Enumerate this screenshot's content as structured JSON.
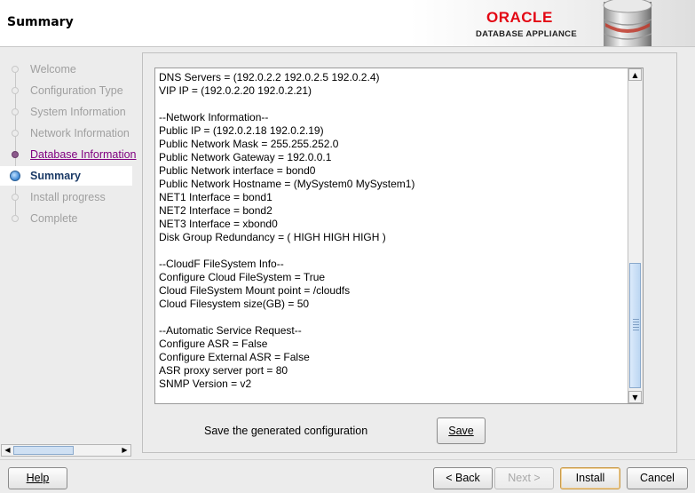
{
  "header": {
    "title": "Summary",
    "brand_oracle": "ORACLE",
    "brand_appliance": "DATABASE APPLIANCE"
  },
  "nav": {
    "steps": [
      {
        "label": "Welcome",
        "state": "done"
      },
      {
        "label": "Configuration Type",
        "state": "done"
      },
      {
        "label": "System Information",
        "state": "done"
      },
      {
        "label": "Network Information",
        "state": "done"
      },
      {
        "label": "Database Information",
        "state": "visited"
      },
      {
        "label": "Summary",
        "state": "current"
      },
      {
        "label": "Install progress",
        "state": "pending"
      },
      {
        "label": "Complete",
        "state": "pending"
      }
    ]
  },
  "summary": {
    "lines": [
      "DNS Servers = (192.0.2.2 192.0.2.5 192.0.2.4)",
      "VIP IP = (192.0.2.20 192.0.2.21)",
      "",
      "--Network Information--",
      "Public IP = (192.0.2.18 192.0.2.19)",
      "Public Network Mask = 255.255.252.0",
      "Public Network Gateway = 192.0.0.1",
      "Public Network interface = bond0",
      "Public Network Hostname = (MySystem0 MySystem1)",
      "NET1 Interface = bond1",
      "NET2 Interface = bond2",
      "NET3 Interface = xbond0",
      "Disk Group Redundancy = ( HIGH HIGH HIGH )",
      "",
      "--CloudF FileSystem Info--",
      "Configure Cloud FileSystem = True",
      "Cloud FileSystem Mount point = /cloudfs",
      "Cloud Filesystem size(GB) = 50",
      "",
      "--Automatic Service Request--",
      "Configure ASR = False",
      "Configure External ASR = False",
      "ASR proxy server port = 80",
      "SNMP Version = v2"
    ]
  },
  "save": {
    "label": "Save the generated configuration",
    "button": "Save"
  },
  "footer": {
    "help": "Help",
    "back": "< Back",
    "next": "Next >",
    "install": "Install",
    "cancel": "Cancel"
  },
  "colors": {
    "visited_link": "#800080",
    "current_step": "#1b3a66",
    "oracle_red": "#e30613"
  }
}
